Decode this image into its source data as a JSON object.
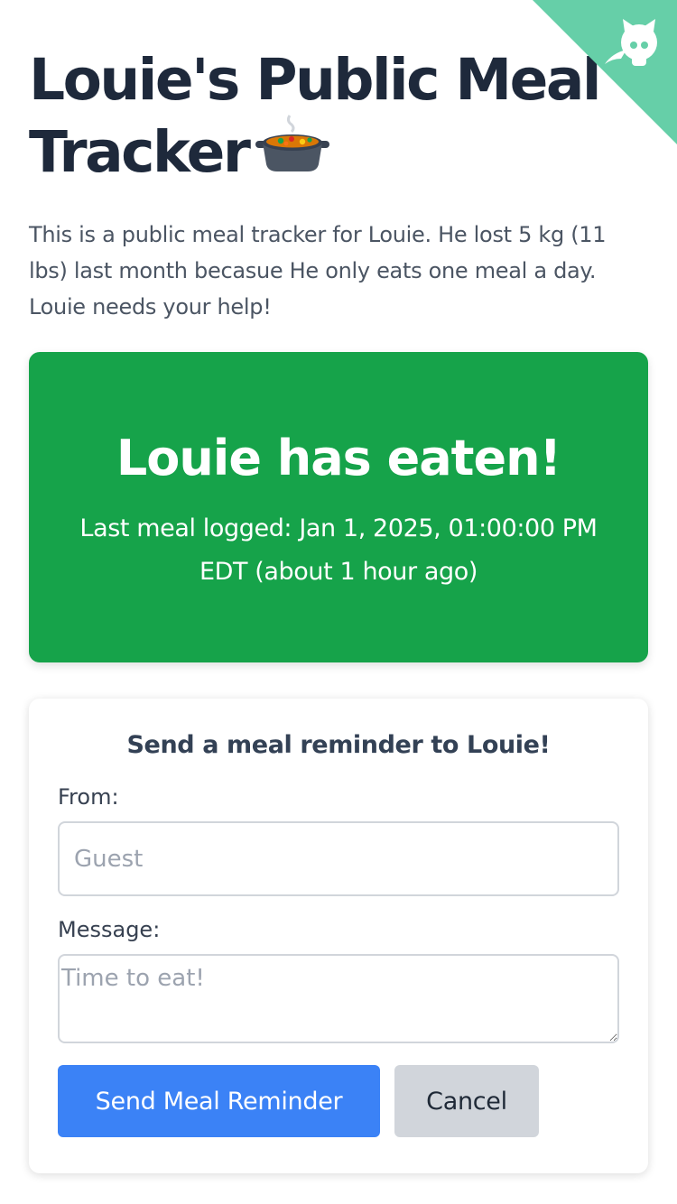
{
  "header": {
    "title": "Louie's Public Meal Tracker",
    "title_icon": "pot-of-food-icon",
    "corner_icon": "github-octocat-icon",
    "corner_color": "#66cfa8"
  },
  "intro": {
    "text": "This is a public meal tracker for Louie. He lost 5 kg (11 lbs) last month becasue He only eats one meal a day. Louie needs your help!"
  },
  "status": {
    "heading": "Louie has eaten!",
    "detail": "Last meal logged: Jan 1, 2025, 01:00:00 PM EDT (about 1 hour ago)",
    "color": "#16a34a"
  },
  "reminder_form": {
    "heading": "Send a meal reminder to Louie!",
    "from_label": "From:",
    "from_placeholder": "Guest",
    "message_label": "Message:",
    "message_placeholder": "Time to eat!",
    "send_label": "Send Meal Reminder",
    "cancel_label": "Cancel",
    "send_color": "#3b82f6",
    "cancel_color": "#d1d5db"
  }
}
